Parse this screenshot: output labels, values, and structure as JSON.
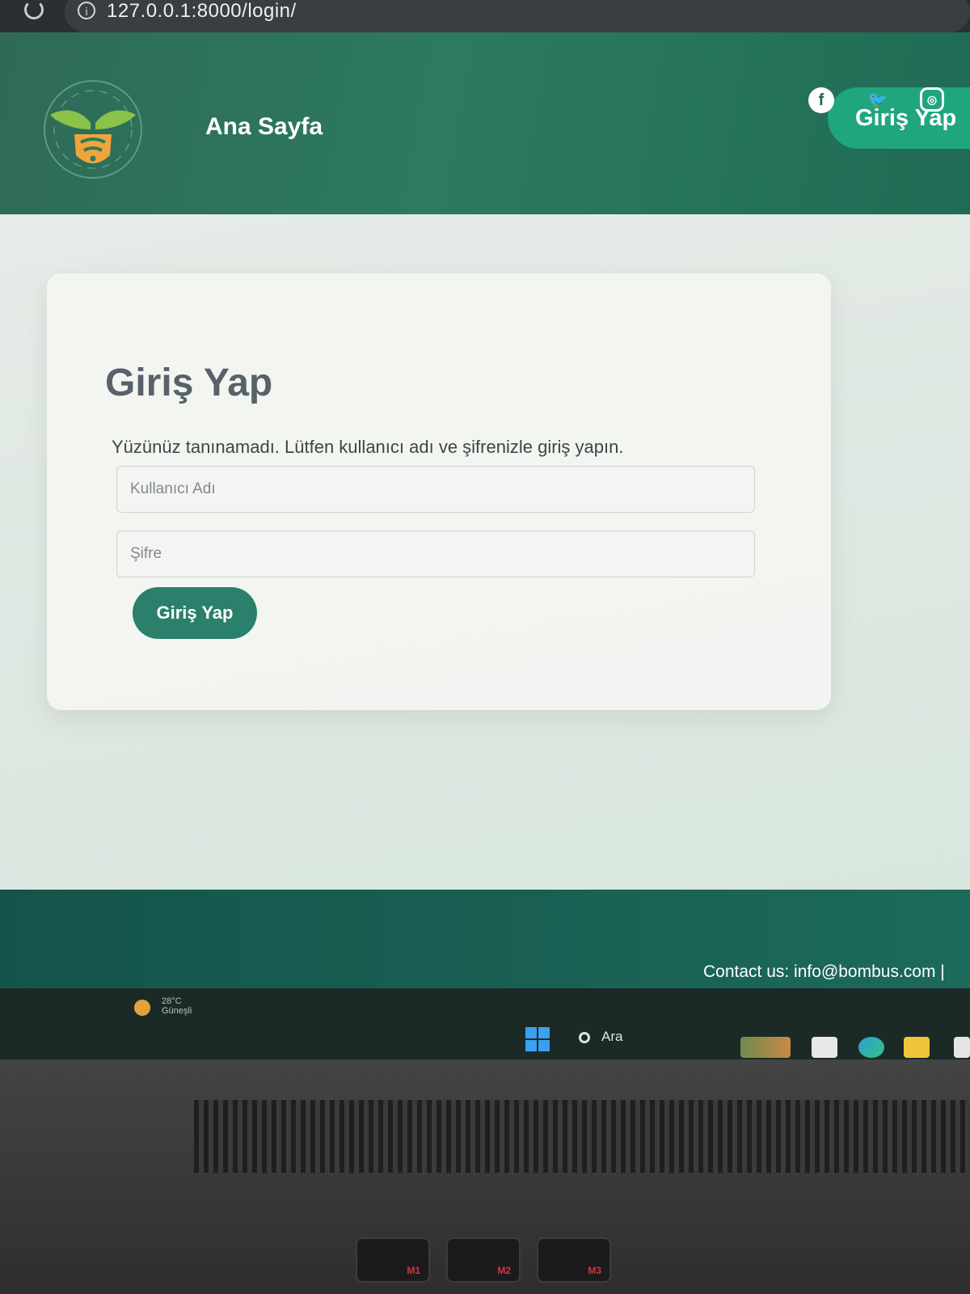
{
  "browser": {
    "url": "127.0.0.1:8000/login/"
  },
  "header": {
    "logo_icon": "bee-shield-leaf-logo",
    "home_label": "Ana Sayfa",
    "login_label": "Giriş Yap"
  },
  "login_card": {
    "title": "Giriş Yap",
    "message": "Yüzünüz tanınamadı. Lütfen kullanıcı adı ve şifrenizle giriş yapın.",
    "username_placeholder": "Kullanıcı Adı",
    "password_placeholder": "Şifre",
    "submit_label": "Giriş Yap"
  },
  "footer": {
    "contact": "Contact us: info@bombus.com |",
    "social_icons": [
      "facebook-icon",
      "twitter-icon",
      "instagram-icon"
    ]
  },
  "taskbar": {
    "weather_temp": "28°C",
    "weather_desc": "Güneşli",
    "search_label": "Ara"
  },
  "keyboard": {
    "keys": [
      "M1",
      "M2",
      "M3"
    ]
  },
  "colors": {
    "header_green": "#2d7a60",
    "accent_green": "#1fa67f",
    "button_green": "#2a806a",
    "footer_green": "#15544b"
  }
}
